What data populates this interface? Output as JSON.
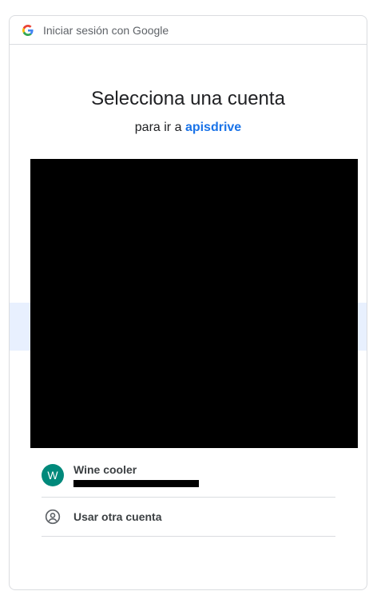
{
  "header": {
    "title": "Iniciar sesión con Google"
  },
  "main": {
    "title": "Selecciona una cuenta",
    "subtitle_prefix": "para ir a",
    "app_name": "apisdrive"
  },
  "accounts": [
    {
      "avatar_letter": "W",
      "name": "Wine cooler",
      "avatar_color": "#00897b"
    }
  ],
  "other_account": {
    "label": "Usar otra cuenta",
    "icon": "person-circle-icon"
  },
  "colors": {
    "link": "#1a73e8",
    "highlight": "#e8f0fe",
    "border": "#dadce0"
  }
}
